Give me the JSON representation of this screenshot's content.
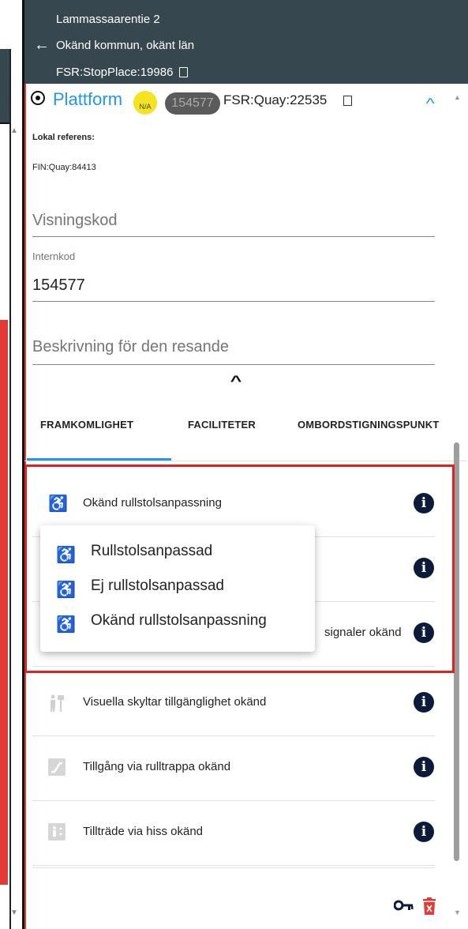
{
  "header": {
    "title": "Lammassaarentie 2",
    "location": "Okänd kommun, okänt län",
    "stop_place_id": "FSR:StopPlace:19986"
  },
  "quay": {
    "title": "Plattform",
    "badge_na": "N/A",
    "badge_id": "154577",
    "quay_id": "FSR:Quay:22535"
  },
  "local_reference": {
    "label": "Lokal referens:",
    "value": "FIN:Quay:84413"
  },
  "fields": {
    "visningskod_placeholder": "Visningskod",
    "internkod_label": "Internkod",
    "internkod_value": "154577",
    "beskrivning_placeholder": "Beskrivning för den resande"
  },
  "tabs": [
    {
      "label": "FRAMKOMLIGHET",
      "active": true
    },
    {
      "label": "FACILITETER",
      "active": false
    },
    {
      "label": "OMBORDSTIGNINGSPUNKT",
      "active": false
    }
  ],
  "accessibility_rows": [
    {
      "label": "Okänd rullstolsanpassning",
      "icon": "wheelchair-icon"
    },
    {
      "label": "",
      "icon": "step-free-icon"
    },
    {
      "label": "signaler okänd",
      "icon": "audio-signal-icon"
    },
    {
      "label": "Visuella skyltar tillgänglighet okänd",
      "icon": "visual-signs-icon"
    },
    {
      "label": "Tillgång via rulltrappa okänd",
      "icon": "escalator-icon"
    },
    {
      "label": "Tillträde via hiss okänd",
      "icon": "lift-icon"
    }
  ],
  "popup_options": [
    {
      "label": "Rullstolsanpassad",
      "icon": "wheelchair-icon",
      "color": "#1a237e"
    },
    {
      "label": "Ej rullstolsanpassad",
      "icon": "wheelchair-icon",
      "color": "#f4511e"
    },
    {
      "label": "Okänd rullstolsanpassning",
      "icon": "wheelchair-icon",
      "color": "#d0d0d0"
    }
  ],
  "colors": {
    "header_bg": "#37474f",
    "accent": "#2196f3",
    "highlight_box": "#e32020",
    "info_icon": "#0d1b3a"
  }
}
